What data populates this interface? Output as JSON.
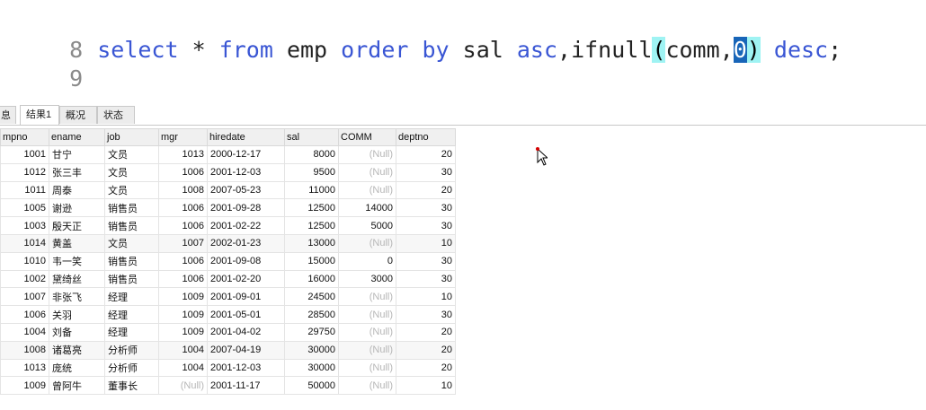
{
  "editor": {
    "lines": [
      {
        "number": "8",
        "tokens": [
          {
            "text": "select",
            "kind": "kw"
          },
          {
            "text": " * ",
            "kind": "id"
          },
          {
            "text": "from",
            "kind": "kw"
          },
          {
            "text": " emp ",
            "kind": "id"
          },
          {
            "text": "order",
            "kind": "kw"
          },
          {
            "text": " ",
            "kind": "id"
          },
          {
            "text": "by",
            "kind": "kw"
          },
          {
            "text": " sal ",
            "kind": "id"
          },
          {
            "text": "asc",
            "kind": "kw"
          },
          {
            "text": ",ifnull",
            "kind": "id"
          },
          {
            "text": "(",
            "kind": "hl"
          },
          {
            "text": "comm,",
            "kind": "id"
          },
          {
            "text": "0",
            "kind": "sel"
          },
          {
            "text": ")",
            "kind": "hl"
          },
          {
            "text": " ",
            "kind": "id"
          },
          {
            "text": "desc",
            "kind": "kw"
          },
          {
            "text": ";",
            "kind": "id"
          }
        ]
      },
      {
        "number": "9",
        "tokens": []
      }
    ]
  },
  "result_tabs": [
    {
      "label": "息",
      "active": false
    },
    {
      "label": "结果1",
      "active": true
    },
    {
      "label": "概况",
      "active": false
    },
    {
      "label": "状态",
      "active": false
    }
  ],
  "table": {
    "columns": [
      "mpno",
      "ename",
      "job",
      "mgr",
      "hiredate",
      "sal",
      "COMM",
      "deptno"
    ],
    "rows": [
      [
        "1001",
        "甘宁",
        "文员",
        "1013",
        "2000-12-17",
        "8000",
        "(Null)",
        "20"
      ],
      [
        "1012",
        "张三丰",
        "文员",
        "1006",
        "2001-12-03",
        "9500",
        "(Null)",
        "30"
      ],
      [
        "1011",
        "周泰",
        "文员",
        "1008",
        "2007-05-23",
        "11000",
        "(Null)",
        "20"
      ],
      [
        "1005",
        "谢逊",
        "销售员",
        "1006",
        "2001-09-28",
        "12500",
        "14000",
        "30"
      ],
      [
        "1003",
        "殷天正",
        "销售员",
        "1006",
        "2001-02-22",
        "12500",
        "5000",
        "30"
      ],
      [
        "1014",
        "黄盖",
        "文员",
        "1007",
        "2002-01-23",
        "13000",
        "(Null)",
        "10"
      ],
      [
        "1010",
        "韦一笑",
        "销售员",
        "1006",
        "2001-09-08",
        "15000",
        "0",
        "30"
      ],
      [
        "1002",
        "黛绮丝",
        "销售员",
        "1006",
        "2001-02-20",
        "16000",
        "3000",
        "30"
      ],
      [
        "1007",
        "非张飞",
        "经理",
        "1009",
        "2001-09-01",
        "24500",
        "(Null)",
        "10"
      ],
      [
        "1006",
        "关羽",
        "经理",
        "1009",
        "2001-05-01",
        "28500",
        "(Null)",
        "30"
      ],
      [
        "1004",
        "刘备",
        "经理",
        "1009",
        "2001-04-02",
        "29750",
        "(Null)",
        "20"
      ],
      [
        "1008",
        "诸葛亮",
        "分析师",
        "1004",
        "2007-04-19",
        "30000",
        "(Null)",
        "20"
      ],
      [
        "1013",
        "庞统",
        "分析师",
        "1004",
        "2001-12-03",
        "30000",
        "(Null)",
        "20"
      ],
      [
        "1009",
        "曾阿牛",
        "董事长",
        "(Null)",
        "2001-11-17",
        "50000",
        "(Null)",
        "10"
      ]
    ]
  },
  "icons": {
    "cursor": "mouse-pointer-icon"
  }
}
